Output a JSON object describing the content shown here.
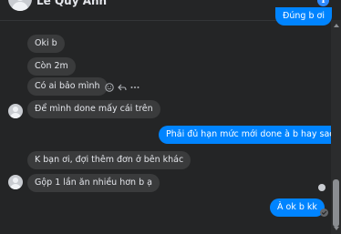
{
  "header": {
    "contact_name": "Lê Quý Anh",
    "info_icon_glyph": "i"
  },
  "messages": [
    {
      "text": "Đúng b ơi",
      "direction": "outgoing"
    },
    {
      "text": "Oki b",
      "direction": "incoming"
    },
    {
      "text": "Còn 2m",
      "direction": "incoming"
    },
    {
      "text": "Có ai bảo mình",
      "direction": "incoming"
    },
    {
      "text": "Để mình done mấy cái trên",
      "direction": "incoming"
    },
    {
      "text": "Phải đủ hạn mức mới done à b hay sao",
      "direction": "outgoing"
    },
    {
      "text": "K bạn ơi, đợi thêm đơn ở bên khác",
      "direction": "incoming"
    },
    {
      "text": "Gộp 1 lần ăn nhiều hơn b ạ",
      "direction": "incoming"
    },
    {
      "text": "À ok b kk",
      "direction": "outgoing"
    }
  ],
  "message_actions": [
    "emoji-react-icon",
    "reply-icon",
    "more-options-icon"
  ],
  "colors": {
    "background": "#242526",
    "incoming_bubble": "#3a3b3c",
    "outgoing_bubble": "#0084ff",
    "text": "#e4e6eb",
    "accent": "#2e89ff"
  }
}
